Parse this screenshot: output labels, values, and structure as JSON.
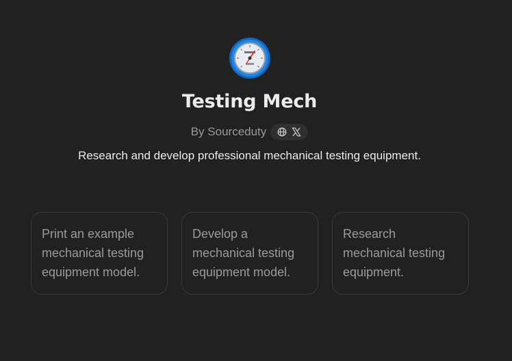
{
  "gpt": {
    "avatar_icon": "pressure-gauge-icon",
    "title": "Testing Mech",
    "byline": "By Sourceduty",
    "social_icons": [
      "globe-icon",
      "x-logo-icon"
    ],
    "description": "Research and develop professional mechanical testing equipment."
  },
  "starters": [
    {
      "label": "Print an example mechanical testing equipment model."
    },
    {
      "label": "Develop a mechanical testing equipment model."
    },
    {
      "label": "Research mechanical testing equipment."
    }
  ],
  "colors": {
    "background": "#212121",
    "title": "#ececec",
    "muted": "#9b9b9b",
    "card_border": "#3a3a3a",
    "avatar_ring": "#1a73d9"
  }
}
